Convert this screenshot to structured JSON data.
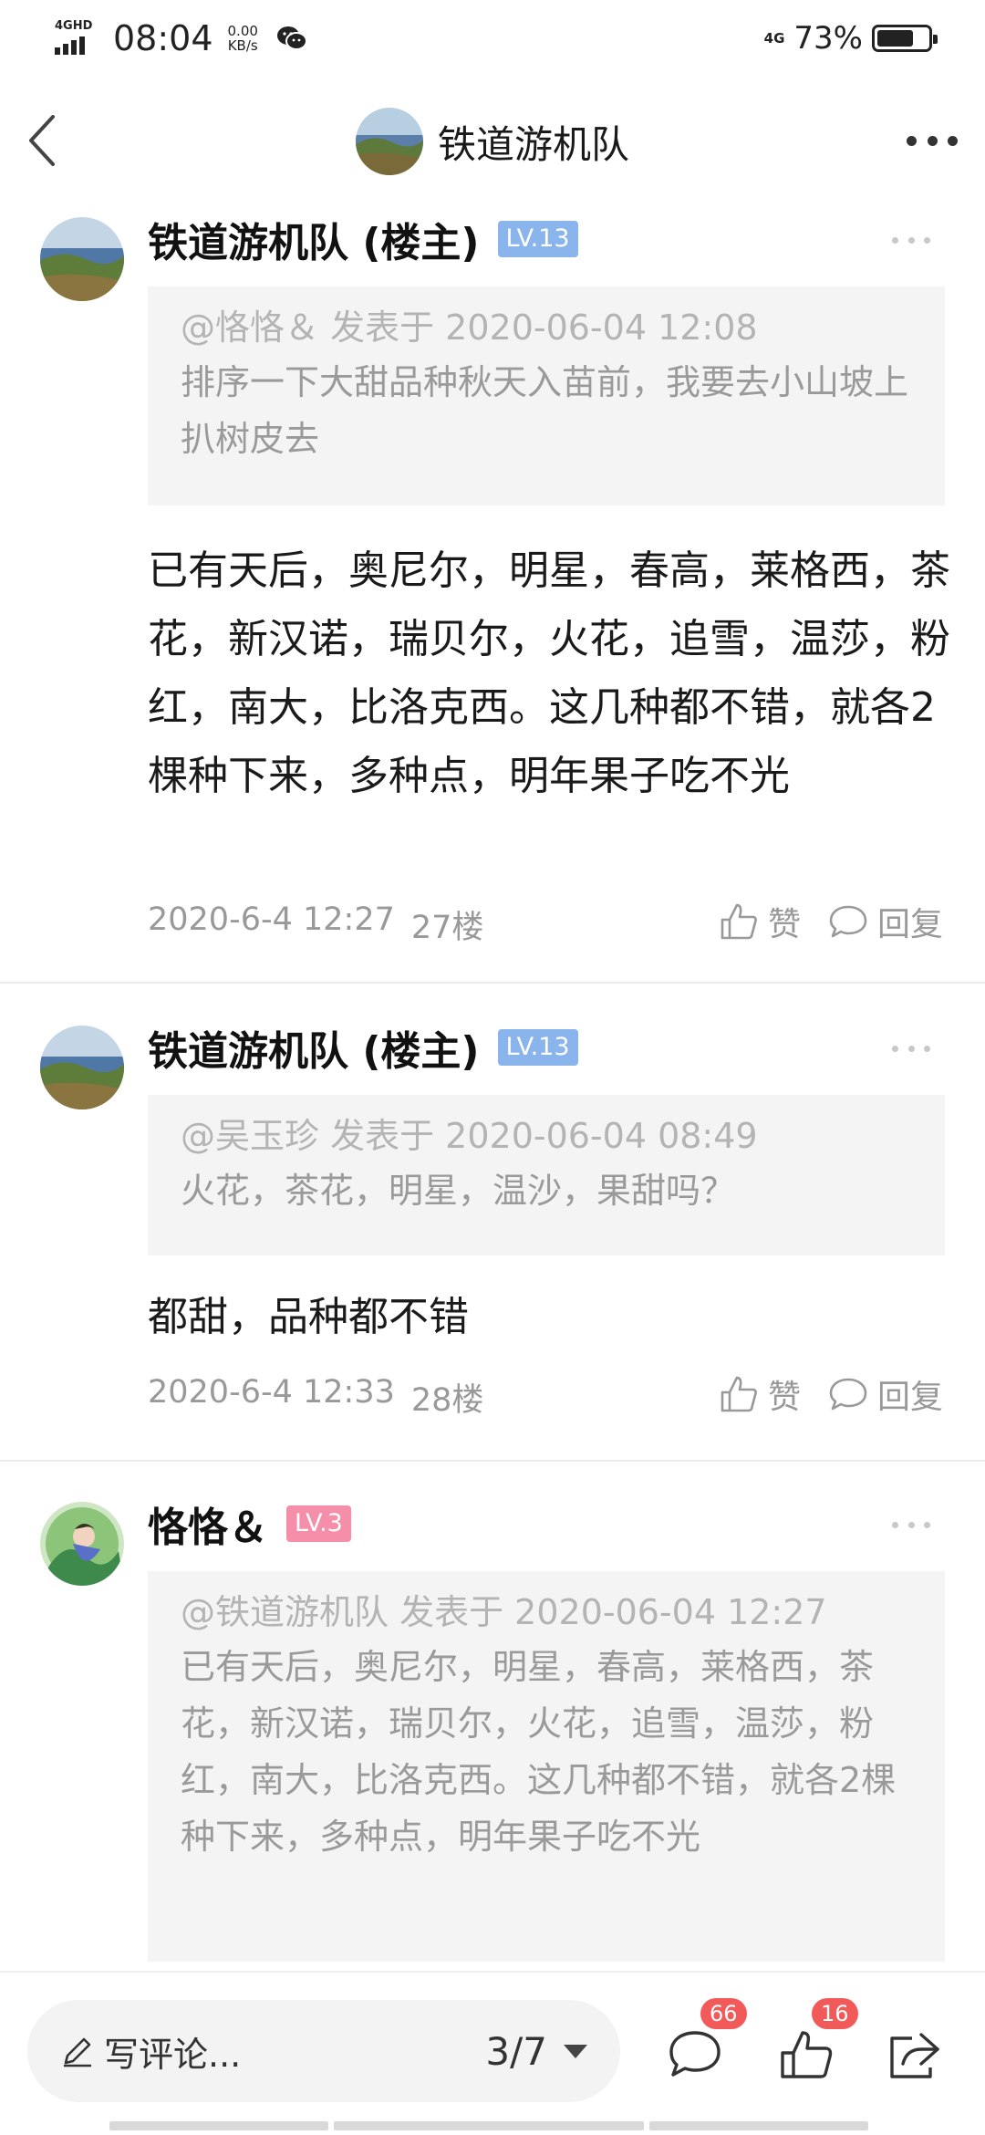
{
  "status_bar": {
    "network_label": "4GHD",
    "time": "08:04",
    "speed_value": "0.00",
    "speed_unit": "KB/s",
    "signal_label": "4G",
    "battery_percent": "73%",
    "battery_level": 0.73
  },
  "header": {
    "title": "铁道游机队"
  },
  "posts": [
    {
      "author": "铁道游机队 (楼主)",
      "level": "LV.13",
      "level_color": "#8ab4ec",
      "quote_head": "@恪恪＆ 发表于 2020-06-04 12:08",
      "quote_body": "排序一下大甜品种秋天入苗前，我要去小山坡上扒树皮去",
      "content": "已有天后，奥尼尔，明星，春高，莱格西，茶花，新汉诺，瑞贝尔，火花，追雪，温莎，粉红，南大，比洛克西。这几种都不错，就各2棵种下来，多种点，明年果子吃不光",
      "date": "2020-6-4 12:27",
      "floor": "27楼",
      "like_label": "赞",
      "reply_label": "回复"
    },
    {
      "author": "铁道游机队 (楼主)",
      "level": "LV.13",
      "level_color": "#8ab4ec",
      "quote_head": "@吴玉珍 发表于 2020-06-04 08:49",
      "quote_body": "火花，茶花，明星，温沙，果甜吗？",
      "content": "都甜，品种都不错",
      "date": "2020-6-4 12:33",
      "floor": "28楼",
      "like_label": "赞",
      "reply_label": "回复"
    },
    {
      "author": "恪恪＆",
      "level": "LV.3",
      "level_color": "#f58ea8",
      "quote_head": "@铁道游机队 发表于 2020-06-04 12:27",
      "quote_body": "已有天后，奥尼尔，明星，春高，莱格西，茶花，新汉诺，瑞贝尔，火花，追雪，温莎，粉红，南大，比洛克西。这几种都不错，就各2棵种下来，多种点，明年果子吃不光"
    }
  ],
  "bottom_bar": {
    "comment_placeholder": "写评论...",
    "page_indicator": "3/7",
    "comments_badge": "66",
    "likes_badge": "16"
  }
}
